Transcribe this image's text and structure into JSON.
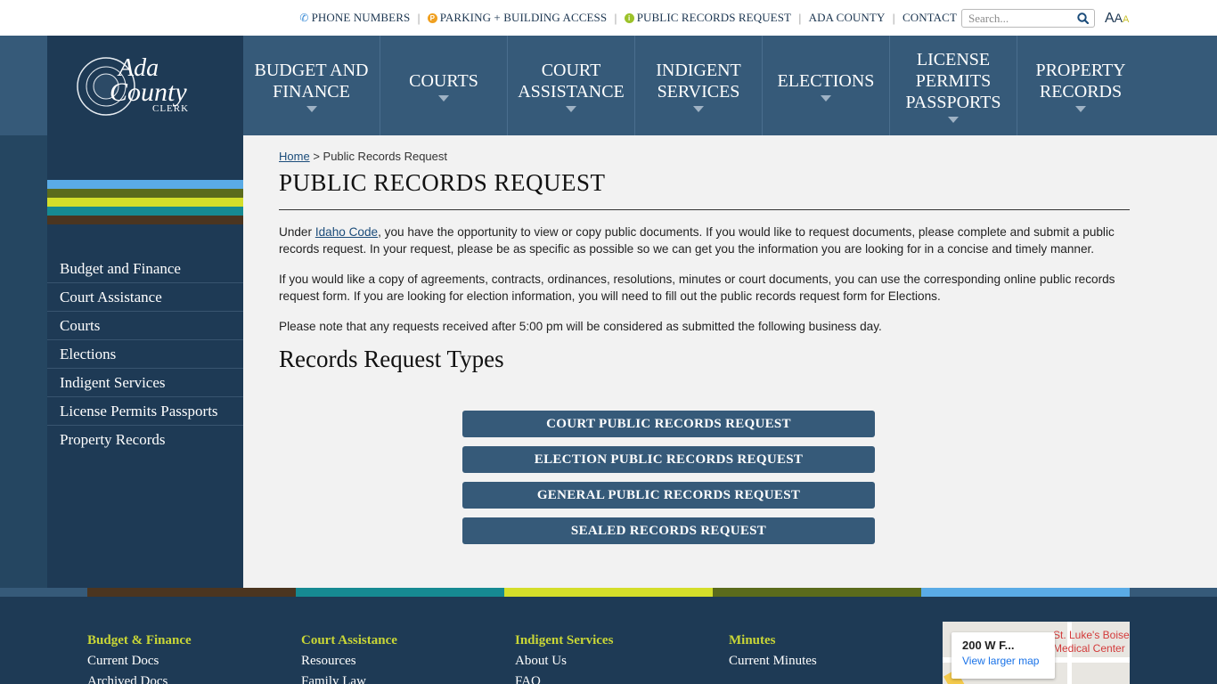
{
  "utility": {
    "links": [
      {
        "label": "PHONE NUMBERS",
        "icon": "phone-icon"
      },
      {
        "label": "PARKING + BUILDING ACCESS",
        "icon": "parking-icon"
      },
      {
        "label": "PUBLIC RECORDS REQUEST",
        "icon": "info-icon"
      },
      {
        "label": "ADA COUNTY"
      },
      {
        "label": "CONTACT"
      }
    ],
    "search_placeholder": "Search...",
    "font_size_labels": [
      "A",
      "A",
      "A"
    ]
  },
  "logo": {
    "line1": "Ada",
    "line2": "County",
    "line3": "CLERK"
  },
  "nav": {
    "items": [
      {
        "label": "BUDGET AND FINANCE",
        "lines": [
          "BUDGET AND",
          "FINANCE"
        ]
      },
      {
        "label": "COURTS",
        "lines": [
          "COURTS"
        ]
      },
      {
        "label": "COURT ASSISTANCE",
        "lines": [
          "COURT",
          "ASSISTANCE"
        ]
      },
      {
        "label": "INDIGENT SERVICES",
        "lines": [
          "INDIGENT",
          "SERVICES"
        ]
      },
      {
        "label": "ELECTIONS",
        "lines": [
          "ELECTIONS"
        ]
      },
      {
        "label": "LICENSE PERMITS PASSPORTS",
        "lines": [
          "LICENSE",
          "PERMITS",
          "PASSPORTS"
        ]
      },
      {
        "label": "PROPERTY RECORDS",
        "lines": [
          "PROPERTY",
          "RECORDS"
        ]
      }
    ]
  },
  "sidebar": {
    "stripe_colors": [
      "#5aabe6",
      "#5b6b1c",
      "#d4de2a",
      "#168a92",
      "#4b3520"
    ],
    "items": [
      {
        "label": "Budget and Finance"
      },
      {
        "label": "Court Assistance"
      },
      {
        "label": "Courts"
      },
      {
        "label": "Elections"
      },
      {
        "label": "Indigent Services"
      },
      {
        "label": "License Permits Passports"
      },
      {
        "label": "Property Records"
      }
    ]
  },
  "breadcrumb": {
    "home": "Home",
    "separator": ">",
    "current": "Public Records Request"
  },
  "page": {
    "title": "PUBLIC RECORDS REQUEST",
    "para1_prefix": "Under ",
    "para1_link": "Idaho Code",
    "para1_suffix": ", you have the opportunity to view or copy public documents.  If you would like to request documents, please complete and submit a public records request. In your request, please be as specific as possible so we can get you the information you are looking for in a concise and timely manner.",
    "para2": "If you would like a copy of agreements, contracts, ordinances, resolutions, minutes or court documents, you can use the corresponding online public records request form. If you are looking for election information, you will need to fill out the public records request form for Elections.",
    "para3": "Please note that any requests received after 5:00 pm will be considered as submitted the following business day.",
    "subtitle": "Records Request Types",
    "buttons": [
      {
        "label": "COURT PUBLIC RECORDS REQUEST"
      },
      {
        "label": "ELECTION PUBLIC RECORDS REQUEST"
      },
      {
        "label": "GENERAL PUBLIC RECORDS REQUEST"
      },
      {
        "label": "SEALED RECORDS REQUEST"
      }
    ]
  },
  "footer": {
    "bar_colors": [
      "#365a79",
      "#4b3520",
      "#168a92",
      "#d4de2a",
      "#5b6b1c",
      "#5aabe6",
      "#365a79"
    ],
    "columns": [
      {
        "heading": "Budget & Finance",
        "links": [
          "Current Docs",
          "Archived Docs"
        ]
      },
      {
        "heading": "Court Assistance",
        "links": [
          "Resources",
          "Family Law"
        ]
      },
      {
        "heading": "Indigent Services",
        "links": [
          "About Us",
          "FAQ"
        ]
      },
      {
        "heading": "Minutes",
        "links": [
          "Current Minutes"
        ]
      }
    ],
    "map": {
      "address": "200 W F...",
      "larger_link": "View larger map",
      "place_label": "St. Luke's Boise Medical Center"
    }
  },
  "colors": {
    "header": "#365a79",
    "sidebar": "#1e3a55",
    "footer": "#1e3a55",
    "accent_yellow": "#c9d636"
  }
}
